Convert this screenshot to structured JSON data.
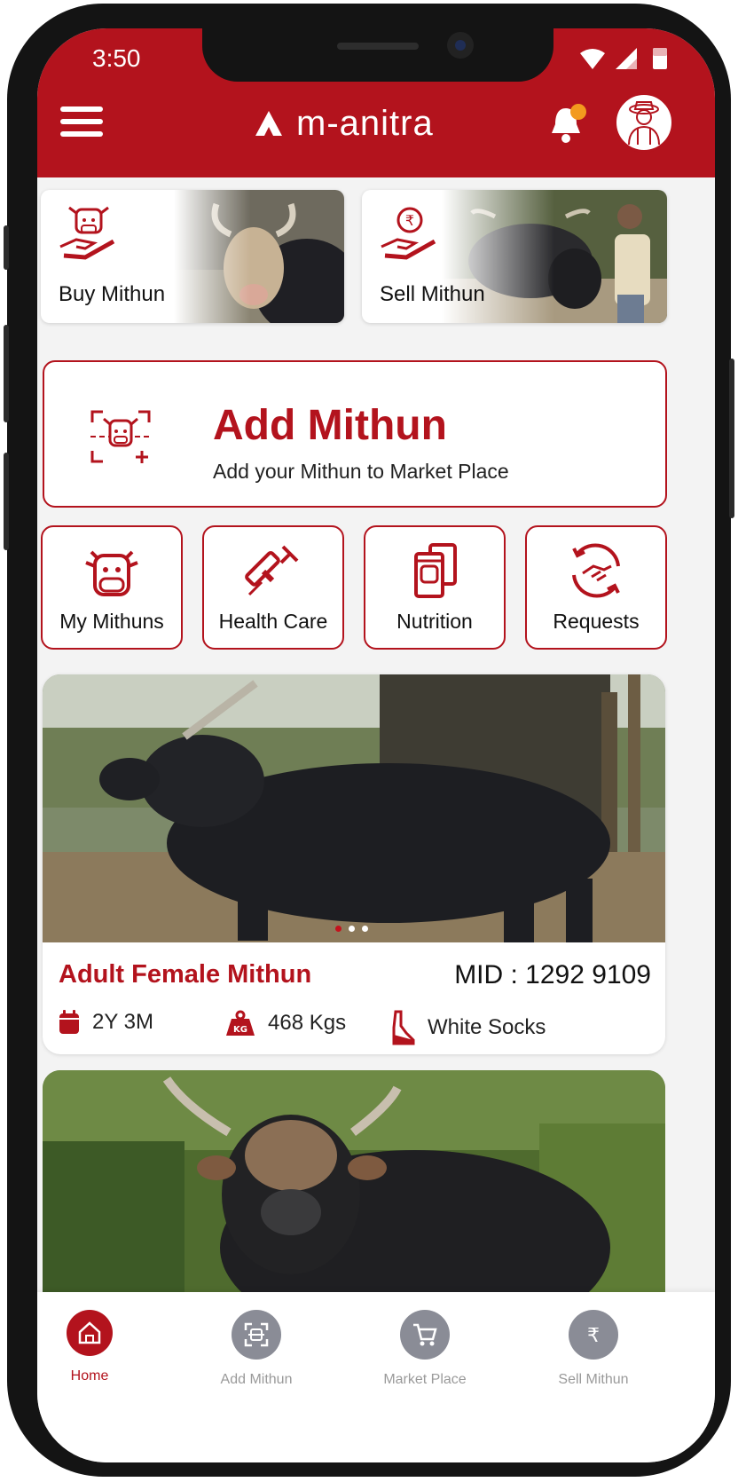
{
  "status_bar": {
    "time": "3:50"
  },
  "header": {
    "app_name": "m-anitra"
  },
  "colors": {
    "brand_red": "#b3131d",
    "notification_dot": "#f39a1e",
    "nav_inactive": "#8a8c96"
  },
  "quick_actions": [
    {
      "label": "Buy Mithun",
      "icon": "buy-mithun-icon"
    },
    {
      "label": "Sell Mithun",
      "icon": "sell-mithun-icon"
    }
  ],
  "add_mithun": {
    "title": "Add Mithun",
    "subtitle": "Add your Mithun to Market Place",
    "icon": "scan-mithun-icon"
  },
  "tiles": [
    {
      "label": "My Mithuns",
      "icon": "cow-icon"
    },
    {
      "label": "Health Care",
      "icon": "syringe-icon"
    },
    {
      "label": "Nutrition",
      "icon": "feed-bag-icon"
    },
    {
      "label": "Requests",
      "icon": "handshake-icon"
    }
  ],
  "listing": {
    "title": "Adult Female Mithun",
    "mid": "MID : 1292 9109",
    "age": "2Y 3M",
    "weight": "468 Kgs",
    "weight_badge": "KG",
    "breed": "White Socks",
    "carousel": {
      "slides": 3,
      "active": 1
    }
  },
  "bottom_nav": [
    {
      "label": "Home",
      "icon": "home-icon",
      "active": true
    },
    {
      "label": "Add Mithun",
      "icon": "scan-icon",
      "active": false
    },
    {
      "label": "Market Place",
      "icon": "cart-icon",
      "active": false
    },
    {
      "label": "Sell Mithun",
      "icon": "rupee-icon",
      "active": false
    }
  ]
}
